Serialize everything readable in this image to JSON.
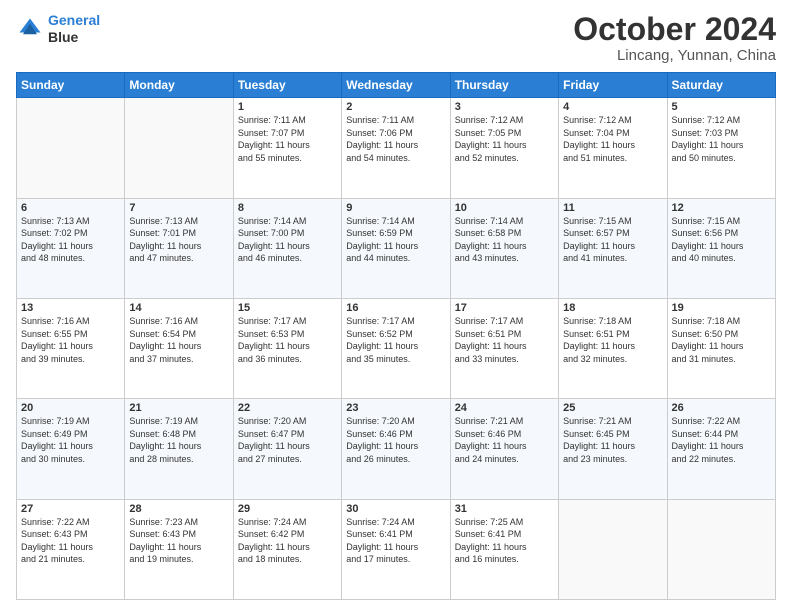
{
  "header": {
    "logo_line1": "General",
    "logo_line2": "Blue",
    "month": "October 2024",
    "location": "Lincang, Yunnan, China"
  },
  "weekdays": [
    "Sunday",
    "Monday",
    "Tuesday",
    "Wednesday",
    "Thursday",
    "Friday",
    "Saturday"
  ],
  "weeks": [
    [
      {
        "day": "",
        "sunrise": "",
        "sunset": "",
        "daylight": ""
      },
      {
        "day": "",
        "sunrise": "",
        "sunset": "",
        "daylight": ""
      },
      {
        "day": "1",
        "sunrise": "Sunrise: 7:11 AM",
        "sunset": "Sunset: 7:07 PM",
        "daylight": "Daylight: 11 hours and 55 minutes."
      },
      {
        "day": "2",
        "sunrise": "Sunrise: 7:11 AM",
        "sunset": "Sunset: 7:06 PM",
        "daylight": "Daylight: 11 hours and 54 minutes."
      },
      {
        "day": "3",
        "sunrise": "Sunrise: 7:12 AM",
        "sunset": "Sunset: 7:05 PM",
        "daylight": "Daylight: 11 hours and 52 minutes."
      },
      {
        "day": "4",
        "sunrise": "Sunrise: 7:12 AM",
        "sunset": "Sunset: 7:04 PM",
        "daylight": "Daylight: 11 hours and 51 minutes."
      },
      {
        "day": "5",
        "sunrise": "Sunrise: 7:12 AM",
        "sunset": "Sunset: 7:03 PM",
        "daylight": "Daylight: 11 hours and 50 minutes."
      }
    ],
    [
      {
        "day": "6",
        "sunrise": "Sunrise: 7:13 AM",
        "sunset": "Sunset: 7:02 PM",
        "daylight": "Daylight: 11 hours and 48 minutes."
      },
      {
        "day": "7",
        "sunrise": "Sunrise: 7:13 AM",
        "sunset": "Sunset: 7:01 PM",
        "daylight": "Daylight: 11 hours and 47 minutes."
      },
      {
        "day": "8",
        "sunrise": "Sunrise: 7:14 AM",
        "sunset": "Sunset: 7:00 PM",
        "daylight": "Daylight: 11 hours and 46 minutes."
      },
      {
        "day": "9",
        "sunrise": "Sunrise: 7:14 AM",
        "sunset": "Sunset: 6:59 PM",
        "daylight": "Daylight: 11 hours and 44 minutes."
      },
      {
        "day": "10",
        "sunrise": "Sunrise: 7:14 AM",
        "sunset": "Sunset: 6:58 PM",
        "daylight": "Daylight: 11 hours and 43 minutes."
      },
      {
        "day": "11",
        "sunrise": "Sunrise: 7:15 AM",
        "sunset": "Sunset: 6:57 PM",
        "daylight": "Daylight: 11 hours and 41 minutes."
      },
      {
        "day": "12",
        "sunrise": "Sunrise: 7:15 AM",
        "sunset": "Sunset: 6:56 PM",
        "daylight": "Daylight: 11 hours and 40 minutes."
      }
    ],
    [
      {
        "day": "13",
        "sunrise": "Sunrise: 7:16 AM",
        "sunset": "Sunset: 6:55 PM",
        "daylight": "Daylight: 11 hours and 39 minutes."
      },
      {
        "day": "14",
        "sunrise": "Sunrise: 7:16 AM",
        "sunset": "Sunset: 6:54 PM",
        "daylight": "Daylight: 11 hours and 37 minutes."
      },
      {
        "day": "15",
        "sunrise": "Sunrise: 7:17 AM",
        "sunset": "Sunset: 6:53 PM",
        "daylight": "Daylight: 11 hours and 36 minutes."
      },
      {
        "day": "16",
        "sunrise": "Sunrise: 7:17 AM",
        "sunset": "Sunset: 6:52 PM",
        "daylight": "Daylight: 11 hours and 35 minutes."
      },
      {
        "day": "17",
        "sunrise": "Sunrise: 7:17 AM",
        "sunset": "Sunset: 6:51 PM",
        "daylight": "Daylight: 11 hours and 33 minutes."
      },
      {
        "day": "18",
        "sunrise": "Sunrise: 7:18 AM",
        "sunset": "Sunset: 6:51 PM",
        "daylight": "Daylight: 11 hours and 32 minutes."
      },
      {
        "day": "19",
        "sunrise": "Sunrise: 7:18 AM",
        "sunset": "Sunset: 6:50 PM",
        "daylight": "Daylight: 11 hours and 31 minutes."
      }
    ],
    [
      {
        "day": "20",
        "sunrise": "Sunrise: 7:19 AM",
        "sunset": "Sunset: 6:49 PM",
        "daylight": "Daylight: 11 hours and 30 minutes."
      },
      {
        "day": "21",
        "sunrise": "Sunrise: 7:19 AM",
        "sunset": "Sunset: 6:48 PM",
        "daylight": "Daylight: 11 hours and 28 minutes."
      },
      {
        "day": "22",
        "sunrise": "Sunrise: 7:20 AM",
        "sunset": "Sunset: 6:47 PM",
        "daylight": "Daylight: 11 hours and 27 minutes."
      },
      {
        "day": "23",
        "sunrise": "Sunrise: 7:20 AM",
        "sunset": "Sunset: 6:46 PM",
        "daylight": "Daylight: 11 hours and 26 minutes."
      },
      {
        "day": "24",
        "sunrise": "Sunrise: 7:21 AM",
        "sunset": "Sunset: 6:46 PM",
        "daylight": "Daylight: 11 hours and 24 minutes."
      },
      {
        "day": "25",
        "sunrise": "Sunrise: 7:21 AM",
        "sunset": "Sunset: 6:45 PM",
        "daylight": "Daylight: 11 hours and 23 minutes."
      },
      {
        "day": "26",
        "sunrise": "Sunrise: 7:22 AM",
        "sunset": "Sunset: 6:44 PM",
        "daylight": "Daylight: 11 hours and 22 minutes."
      }
    ],
    [
      {
        "day": "27",
        "sunrise": "Sunrise: 7:22 AM",
        "sunset": "Sunset: 6:43 PM",
        "daylight": "Daylight: 11 hours and 21 minutes."
      },
      {
        "day": "28",
        "sunrise": "Sunrise: 7:23 AM",
        "sunset": "Sunset: 6:43 PM",
        "daylight": "Daylight: 11 hours and 19 minutes."
      },
      {
        "day": "29",
        "sunrise": "Sunrise: 7:24 AM",
        "sunset": "Sunset: 6:42 PM",
        "daylight": "Daylight: 11 hours and 18 minutes."
      },
      {
        "day": "30",
        "sunrise": "Sunrise: 7:24 AM",
        "sunset": "Sunset: 6:41 PM",
        "daylight": "Daylight: 11 hours and 17 minutes."
      },
      {
        "day": "31",
        "sunrise": "Sunrise: 7:25 AM",
        "sunset": "Sunset: 6:41 PM",
        "daylight": "Daylight: 11 hours and 16 minutes."
      },
      {
        "day": "",
        "sunrise": "",
        "sunset": "",
        "daylight": ""
      },
      {
        "day": "",
        "sunrise": "",
        "sunset": "",
        "daylight": ""
      }
    ]
  ]
}
